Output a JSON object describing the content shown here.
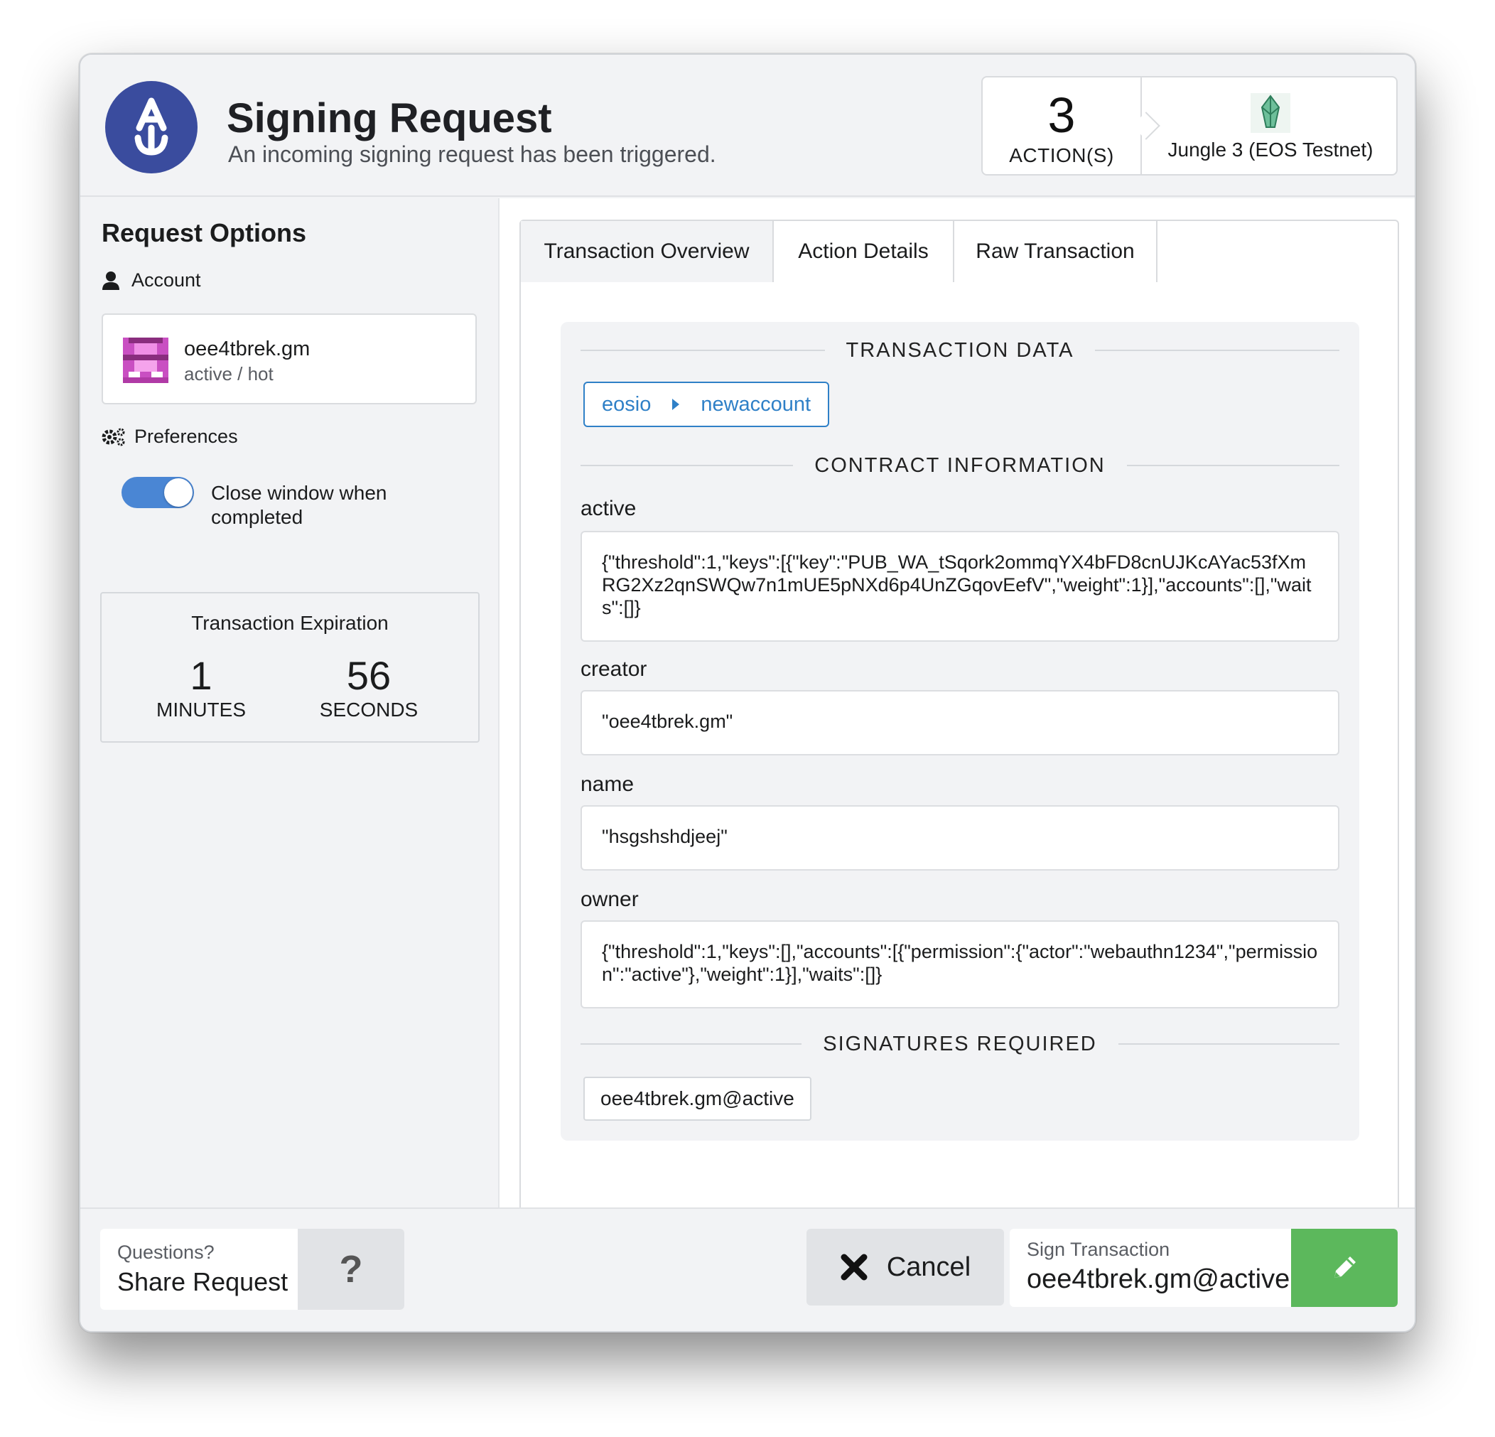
{
  "header": {
    "title": "Signing Request",
    "subtitle": "An incoming signing request has been triggered.",
    "actions_count": "3",
    "actions_label": "ACTION(S)",
    "chain_name": "Jungle 3 (EOS Testnet)"
  },
  "left": {
    "title": "Request Options",
    "account_label": "Account",
    "account_name": "oee4tbrek.gm",
    "account_permission": "active / hot",
    "preferences_label": "Preferences",
    "toggle_label": "Close window when completed",
    "toggle_on": true,
    "expiration": {
      "title": "Transaction Expiration",
      "minutes": "1",
      "minutes_label": "MINUTES",
      "seconds": "56",
      "seconds_label": "SECONDS"
    }
  },
  "tabs": [
    {
      "label": "Transaction Overview",
      "active": true
    },
    {
      "label": "Action Details",
      "active": false
    },
    {
      "label": "Raw Transaction",
      "active": false
    }
  ],
  "overview": {
    "transaction_data_heading": "TRANSACTION DATA",
    "contract": "eosio",
    "action": "newaccount",
    "contract_info_heading": "CONTRACT INFORMATION",
    "fields": [
      {
        "label": "active",
        "value": "{\"threshold\":1,\"keys\":[{\"key\":\"PUB_WA_tSqork2ommqYX4bFD8cnUJKcAYac53fXmRG2Xz2qnSWQw7n1mUE5pNXd6p4UnZGqovEefV\",\"weight\":1}],\"accounts\":[],\"waits\":[]}"
      },
      {
        "label": "creator",
        "value": "\"oee4tbrek.gm\""
      },
      {
        "label": "name",
        "value": "\"hsgshshdjeej\""
      },
      {
        "label": "owner",
        "value": "{\"threshold\":1,\"keys\":[],\"accounts\":[{\"permission\":{\"actor\":\"webauthn1234\",\"permission\":\"active\"},\"weight\":1}],\"waits\":[]}"
      }
    ],
    "signatures_heading": "SIGNATURES REQUIRED",
    "signature": "oee4tbrek.gm@active"
  },
  "footer": {
    "share_small": "Questions?",
    "share_big": "Share Request",
    "share_icon": "?",
    "cancel_label": "Cancel",
    "sign_small": "Sign Transaction",
    "sign_big": "oee4tbrek.gm@active"
  },
  "colors": {
    "logo_blue": "#3a4c9e",
    "accent_blue": "#2f80c7",
    "toggle_blue": "#4a86d4",
    "sign_green": "#5cb85c"
  }
}
